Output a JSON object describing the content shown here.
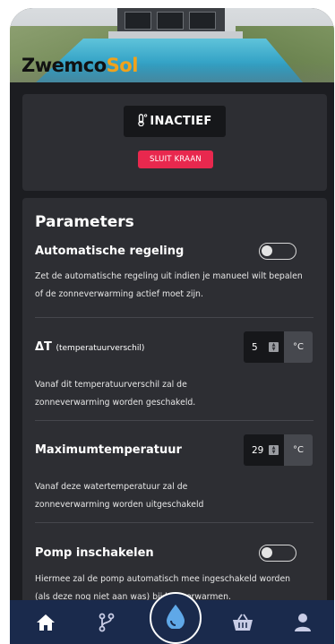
{
  "brand": {
    "name_part1": "Zwemco",
    "name_part2": "Sol"
  },
  "status": {
    "label": "INACTIEF",
    "button": "SLUIT KRAAN"
  },
  "parameters": {
    "title": "Parameters",
    "auto": {
      "title": "Automatische regeling",
      "enabled": false,
      "description": "Zet de automatische regeling uit indien je manueel wilt bepalen of de zonneverwarming actief moet zijn."
    },
    "delta": {
      "title": "ΔT",
      "subtitle": "(temperatuurverschil)",
      "value": "5",
      "unit": "°C",
      "description": "Vanaf dit temperatuurverschil zal de zonneverwarming worden geschakeld."
    },
    "max": {
      "title": "Maximumtemperatuur",
      "value": "29",
      "unit": "°C",
      "description": "Vanaf deze watertemperatuur zal de zonneverwarming worden uitgeschakeld"
    },
    "pump": {
      "title": "Pomp inschakelen",
      "enabled": false,
      "description": "Hiermee zal de pomp automatisch mee ingeschakeld worden (als deze nog niet aan was) bij het verwarmen."
    }
  },
  "nav": {
    "items": [
      "home-icon",
      "branch-icon",
      "water-drop-icon",
      "basket-icon",
      "user-icon"
    ],
    "active": "water-drop-icon"
  },
  "colors": {
    "background": "#1c1d21",
    "card": "#2d2e33",
    "accent_button": "#e8284e",
    "nav": "#1a2a4c",
    "brand_sol": "#f0a21c"
  }
}
